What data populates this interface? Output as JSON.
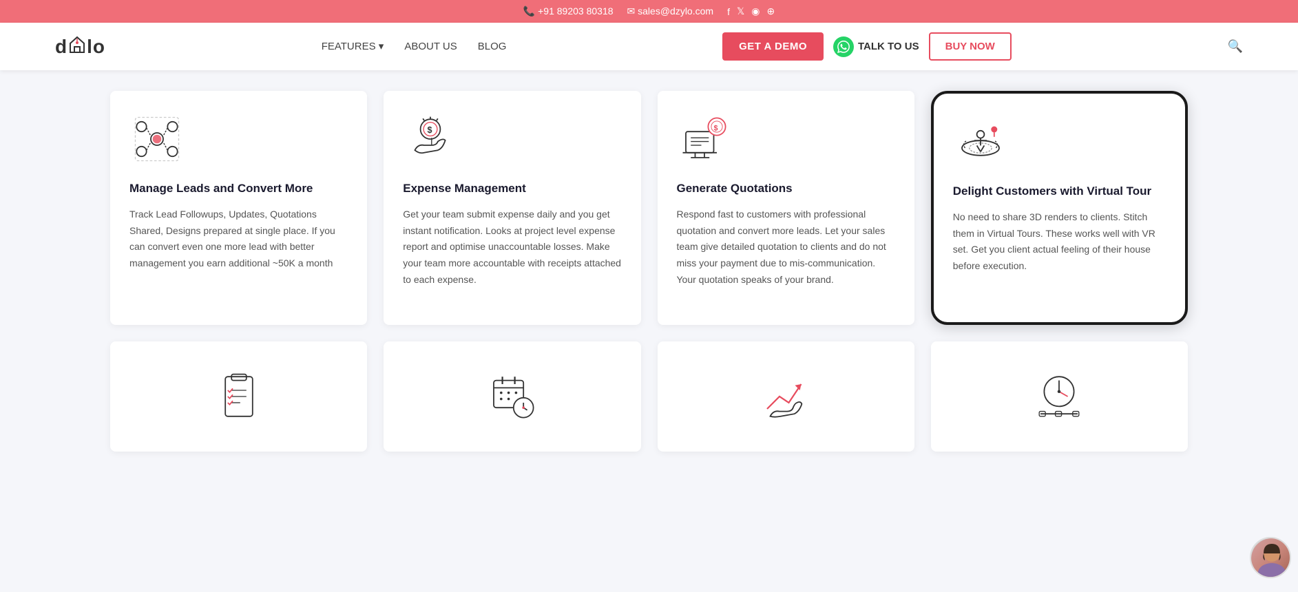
{
  "topbar": {
    "phone": "+91 89203 80318",
    "email": "sales@dzylo.com",
    "social": [
      "facebook",
      "twitter",
      "instagram",
      "rss"
    ]
  },
  "navbar": {
    "logo": "dzylo",
    "links": [
      {
        "label": "FEATURES",
        "hasDropdown": true
      },
      {
        "label": "ABOUT US"
      },
      {
        "label": "BLOG"
      }
    ],
    "cta_demo": "GET A DEMO",
    "cta_talk": "TALK TO US",
    "cta_buy": "BUY NOW"
  },
  "cards": [
    {
      "id": "manage-leads",
      "title": "Manage Leads and Convert More",
      "desc": "Track Lead Followups, Updates, Quotations Shared, Designs prepared at single place. If you can convert even one more lead with better management you earn additional  ~50K a month",
      "highlighted": false
    },
    {
      "id": "expense-management",
      "title": "Expense Management",
      "desc": "Get your team submit expense daily and you get instant notification. Looks at project level expense report and optimise unaccountable losses. Make your team more accountable with receipts attached to each expense.",
      "highlighted": false
    },
    {
      "id": "generate-quotations",
      "title": "Generate Quotations",
      "desc": "Respond fast to customers with professional quotation and convert more leads. Let your sales team give detailed quotation to clients and do not miss your payment due to mis-communication. Your quotation speaks of your brand.",
      "highlighted": false
    },
    {
      "id": "virtual-tour",
      "title": "Delight Customers with Virtual Tour",
      "desc": "No need to share 3D renders to clients. Stitch them in Virtual Tours. These works well with VR set. Get you client actual feeling of their house before execution.",
      "highlighted": true
    }
  ],
  "bottom_cards": [
    {
      "id": "task-list",
      "icon": "checklist"
    },
    {
      "id": "schedule",
      "icon": "calendar-clock"
    },
    {
      "id": "growth",
      "icon": "graph-hand"
    },
    {
      "id": "timeline",
      "icon": "clock-timeline"
    }
  ]
}
